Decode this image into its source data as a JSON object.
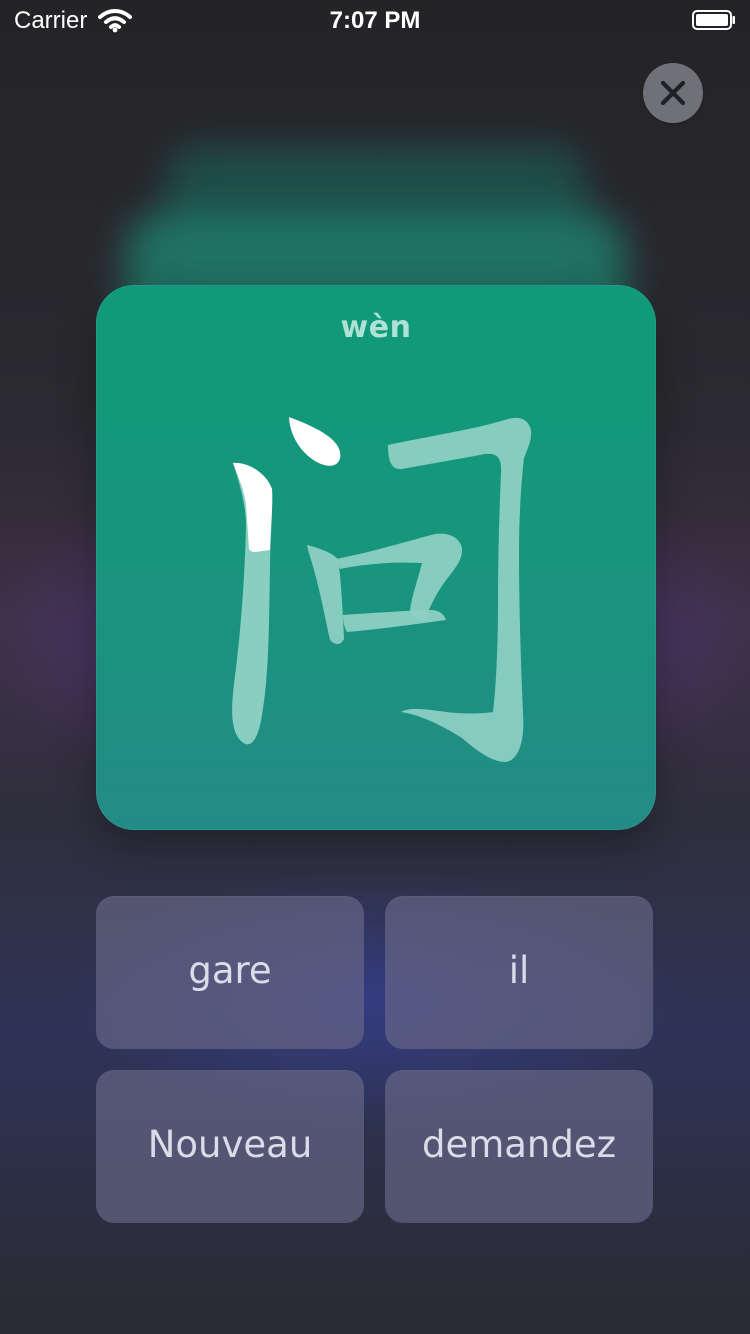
{
  "status_bar": {
    "carrier": "Carrier",
    "time": "7:07 PM",
    "icons": [
      "wifi-icon",
      "battery-icon"
    ]
  },
  "header": {
    "close_icon": "close-icon"
  },
  "flashcard": {
    "pinyin": "wèn",
    "character": "问",
    "colors": {
      "card_top": "#109a79",
      "card_bottom": "#238b86",
      "stroke_highlight": "#ffffff",
      "stroke_muted": "#8ccfc3"
    }
  },
  "answers": [
    {
      "label": "gare"
    },
    {
      "label": "il"
    },
    {
      "label": "Nouveau"
    },
    {
      "label": "demandez"
    }
  ]
}
